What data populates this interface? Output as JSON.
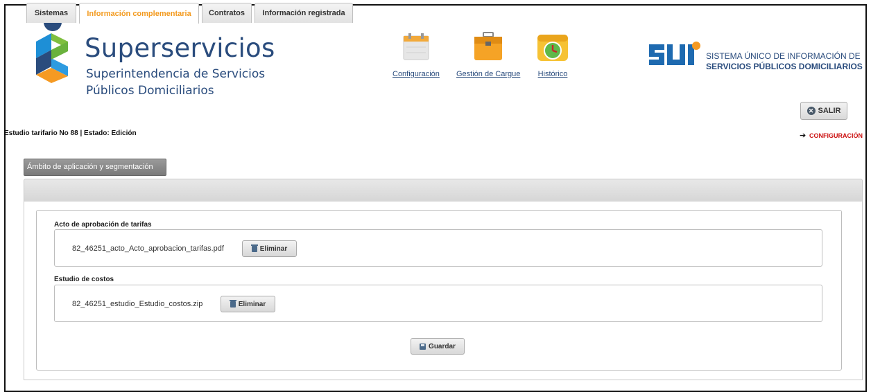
{
  "brand": {
    "title": "Superservicios",
    "subtitle_line1": "Superintendencia de Servicios",
    "subtitle_line2": "Públicos Domiciliarios"
  },
  "nav": {
    "items": [
      {
        "label": "Configuración",
        "icon": "calendar-icon"
      },
      {
        "label": "Gestión de Cargue",
        "icon": "briefcase-icon"
      },
      {
        "label": "Histórico",
        "icon": "history-clock-icon"
      }
    ]
  },
  "sui": {
    "logo_text": "SUI",
    "line1": "SISTEMA ÚNICO DE INFORMACIÓN DE",
    "line2": "SERVICIOS PÚBLICOS DOMICILIARIOS"
  },
  "header": {
    "salir_label": "SALIR",
    "estudio_status": "Estudio tarifario No 88 | Estado: Edición",
    "config_link": "CONFIGURACIÓN"
  },
  "ambito_button": "Ámbito de aplicación y segmentación",
  "tabs": [
    {
      "label": "Sistemas",
      "active": false
    },
    {
      "label": "Información complementaria",
      "active": true
    },
    {
      "label": "Contratos",
      "active": false
    },
    {
      "label": "Información registrada",
      "active": false
    }
  ],
  "sections": {
    "acto": {
      "label": "Acto de aprobación de tarifas",
      "file": "82_46251_acto_Acto_aprobacion_tarifas.pdf",
      "delete_label": "Eliminar"
    },
    "estudio": {
      "label": "Estudio de costos",
      "file": "82_46251_estudio_Estudio_costos.zip",
      "delete_label": "Eliminar"
    }
  },
  "save_label": "Guardar",
  "colors": {
    "brand_blue": "#2a4c7d",
    "active_tab": "#f39a1e",
    "config_link": "#cc1111"
  }
}
